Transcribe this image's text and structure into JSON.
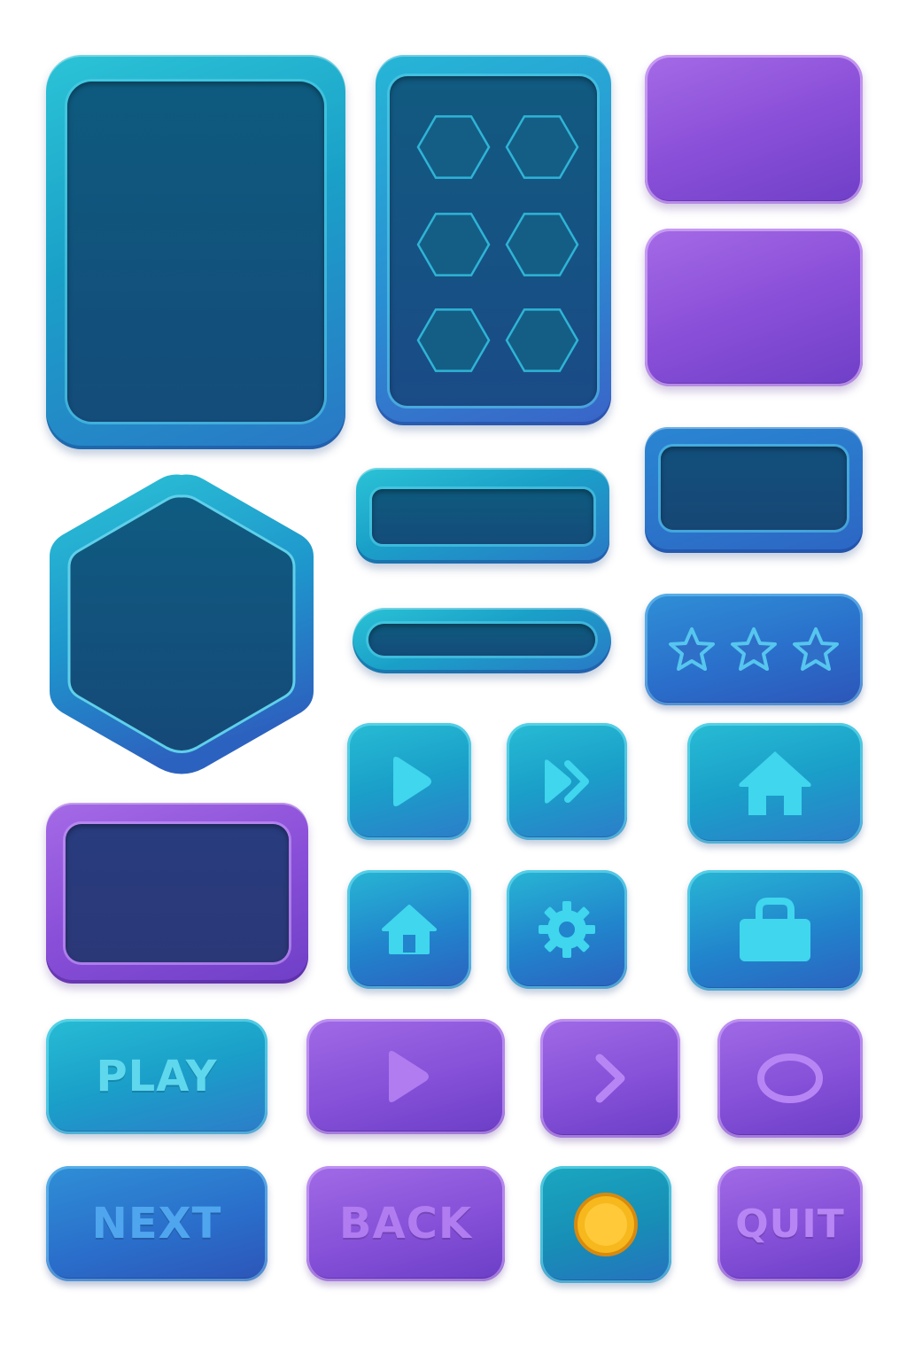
{
  "colors": {
    "teal": "#1aa0c8",
    "blue": "#2a6fcb",
    "purple": "#8650d8",
    "well": "#124e78",
    "icon": "#3fd3ec",
    "gold": "#f6b81c"
  },
  "panels": {
    "large_panel": "frame",
    "hex_grid_panel": {
      "slot_count": 6,
      "slot_icon": "hexagon-icon"
    },
    "purple_plates": 2,
    "hex_panel": "hexagon-frame",
    "purple_panel": "frame"
  },
  "rating": {
    "stars": 3,
    "icon": "star-icon"
  },
  "icon_buttons": [
    {
      "name": "play-icon"
    },
    {
      "name": "fast-forward-icon"
    },
    {
      "name": "home-icon"
    },
    {
      "name": "home-small-icon"
    },
    {
      "name": "gear-icon"
    },
    {
      "name": "lock-icon"
    }
  ],
  "buttons": {
    "play": "PLAY",
    "next": "NEXT",
    "back": "BACK",
    "quit": "QUIT",
    "purple_play_icon": "play-icon",
    "chevron_icon": "chevron-right-icon",
    "circle_icon": "circle-icon",
    "coin_icon": "coin-icon"
  }
}
